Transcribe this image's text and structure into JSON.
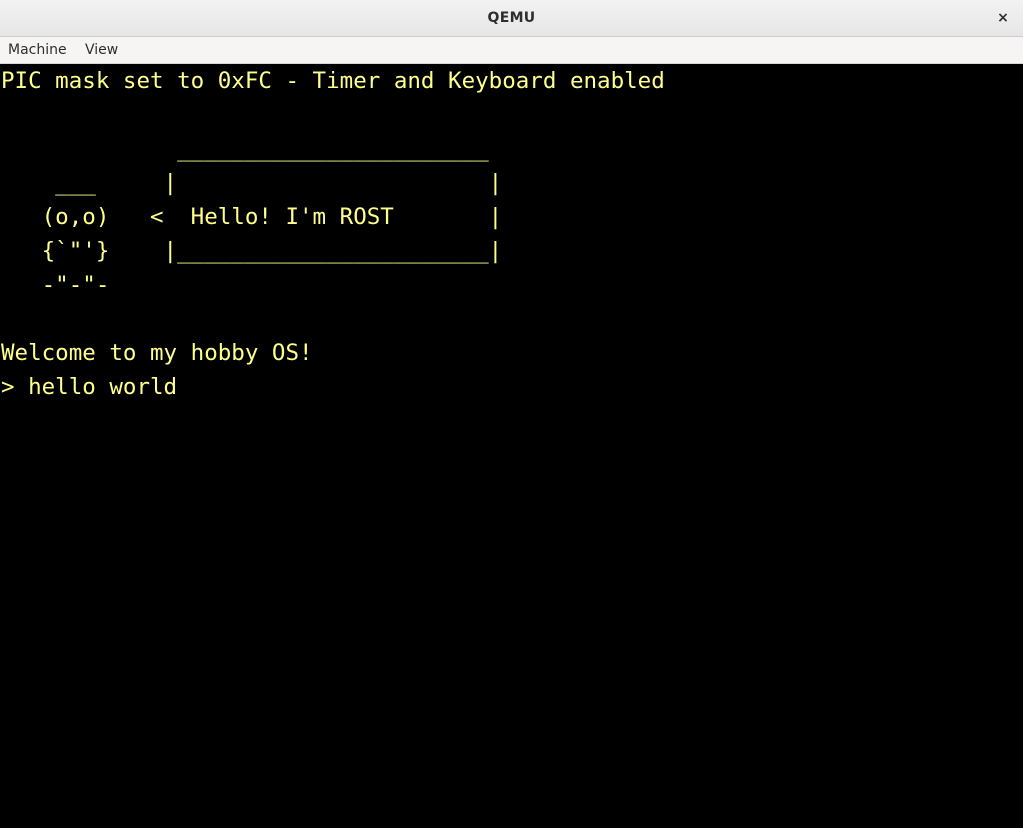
{
  "window": {
    "title": "QEMU",
    "close_glyph": "×"
  },
  "menubar": {
    "items": [
      {
        "label": "Machine"
      },
      {
        "label": "View"
      }
    ]
  },
  "console": {
    "text_color": "#ffff8c",
    "background": "#000000",
    "lines": [
      "PIC mask set to 0xFC - Timer and Keyboard enabled",
      "",
      "             _______________________",
      "    ___     |                       |",
      "   (o,o)   <  Hello! I'm ROST       |",
      "   {`\"'}    |_______________________|",
      "   -\"-\"-",
      "",
      "Welcome to my hobby OS!",
      "> hello world"
    ]
  }
}
